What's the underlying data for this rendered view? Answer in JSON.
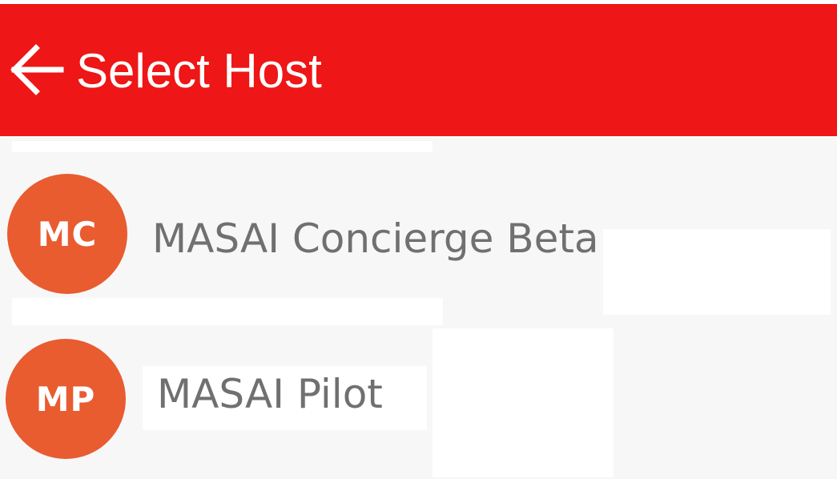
{
  "header": {
    "title": "Select Host",
    "back_icon": "arrow-left-icon",
    "background_color": "#ee1616"
  },
  "hosts": [
    {
      "initials": "MC",
      "name": "MASAI Concierge Beta",
      "avatar_color": "#e85c30"
    },
    {
      "initials": "MP",
      "name": "MASAI Pilot",
      "avatar_color": "#e85c30"
    }
  ]
}
